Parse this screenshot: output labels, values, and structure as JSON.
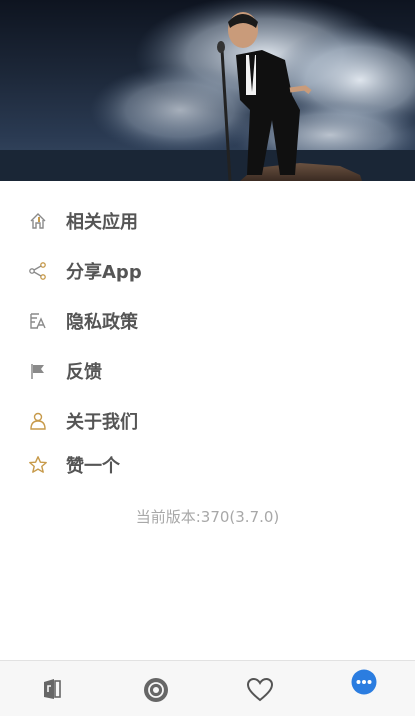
{
  "menu": {
    "items": [
      {
        "label": "相关应用",
        "icon": "related-apps-icon"
      },
      {
        "label": "分享App",
        "icon": "share-icon"
      },
      {
        "label": "隐私政策",
        "icon": "privacy-policy-icon"
      },
      {
        "label": "反馈",
        "icon": "flag-icon"
      },
      {
        "label": "关于我们",
        "icon": "user-icon"
      },
      {
        "label": "赞一个",
        "icon": "star-icon"
      }
    ]
  },
  "version": {
    "text": "当前版本:370(3.7.0)"
  },
  "tabbar": {
    "tabs": [
      {
        "icon": "library-icon",
        "active": false
      },
      {
        "icon": "disc-icon",
        "active": false
      },
      {
        "icon": "heart-icon",
        "active": false
      },
      {
        "icon": "more-icon",
        "active": true
      }
    ]
  },
  "colors": {
    "accent": "#2b7de0",
    "label": "#555555",
    "icon": "#8a8a8a",
    "icon_warm": "#c79a4a"
  }
}
